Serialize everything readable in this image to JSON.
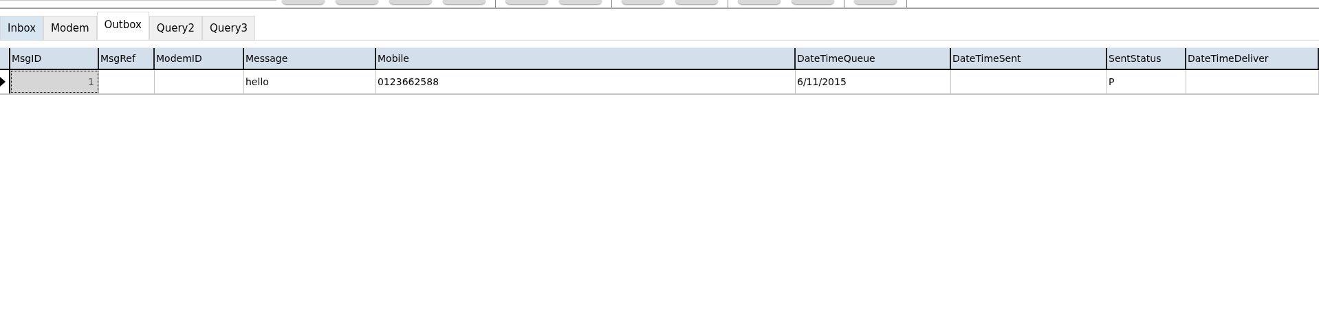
{
  "toolbar": {
    "buttons": [
      {
        "kind": "button"
      },
      {
        "kind": "button"
      },
      {
        "kind": "button"
      },
      {
        "kind": "button"
      },
      {
        "kind": "separator"
      },
      {
        "kind": "button"
      },
      {
        "kind": "button"
      },
      {
        "kind": "separator"
      },
      {
        "kind": "button"
      },
      {
        "kind": "button"
      },
      {
        "kind": "separator"
      },
      {
        "kind": "button"
      },
      {
        "kind": "button"
      },
      {
        "kind": "separator"
      },
      {
        "kind": "button"
      },
      {
        "kind": "separator"
      }
    ]
  },
  "tabs": [
    {
      "label": "Inbox",
      "selected": false,
      "hovered": true
    },
    {
      "label": "Modem",
      "selected": false,
      "hovered": false
    },
    {
      "label": "Outbox",
      "selected": true,
      "hovered": false
    },
    {
      "label": "Query2",
      "selected": false,
      "hovered": false
    },
    {
      "label": "Query3",
      "selected": false,
      "hovered": false
    }
  ],
  "table": {
    "columns": [
      "MsgID",
      "MsgRef",
      "ModemID",
      "Message",
      "Mobile",
      "DateTimeQueue",
      "DateTimeSent",
      "SentStatus",
      "DateTimeDeliver"
    ],
    "rows": [
      {
        "current": true,
        "cells": [
          {
            "text": "1",
            "selected": true
          },
          {
            "text": "",
            "selected": false
          },
          {
            "text": "",
            "selected": false
          },
          {
            "text": "hello",
            "selected": false
          },
          {
            "text": "0123662588",
            "selected": false
          },
          {
            "text": "6/11/2015",
            "selected": false
          },
          {
            "text": "",
            "selected": false
          },
          {
            "text": "P",
            "selected": false
          },
          {
            "text": "",
            "selected": false
          }
        ]
      }
    ]
  }
}
